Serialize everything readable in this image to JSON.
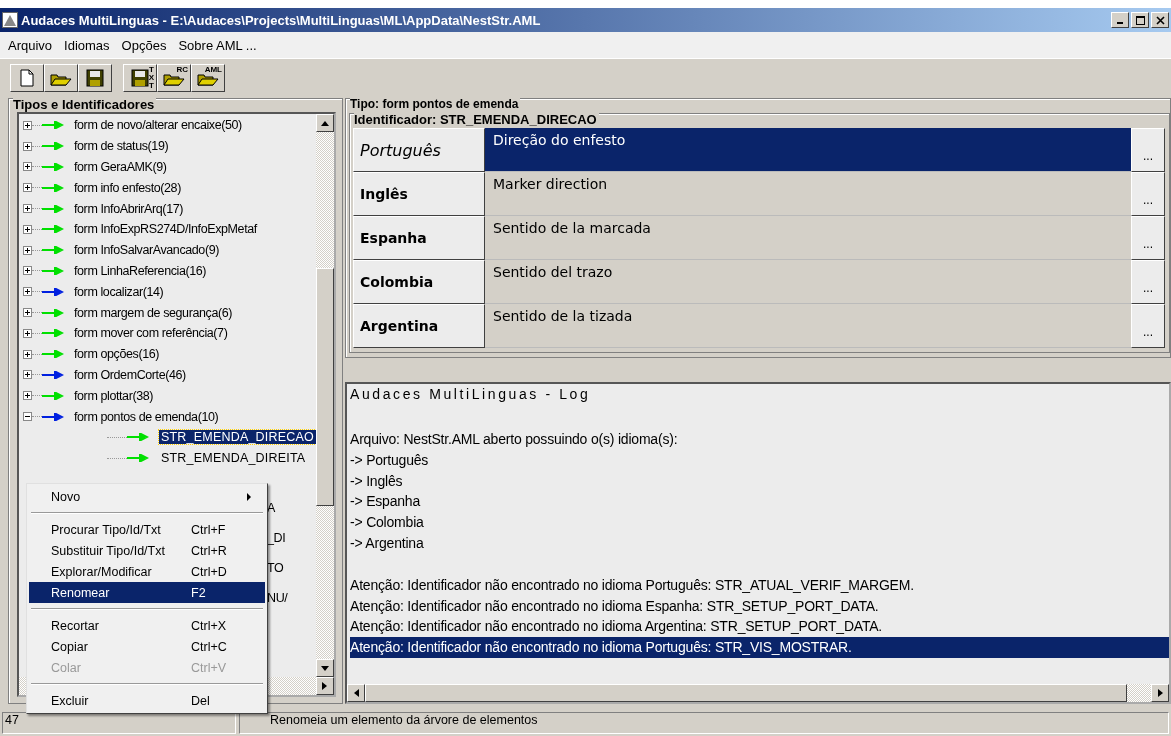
{
  "window": {
    "title": "Audaces MultiLinguas - E:\\Audaces\\Projects\\MultiLinguas\\ML\\AppData\\NestStr.AML"
  },
  "menu": [
    "Arquivo",
    "Idiomas",
    "Opções",
    "Sobre AML ..."
  ],
  "toolbar": [
    {
      "kind": "new"
    },
    {
      "kind": "open"
    },
    {
      "kind": "save"
    },
    {
      "kind": "save",
      "tag": "TXT"
    },
    {
      "kind": "open",
      "tag": "RC"
    },
    {
      "kind": "open",
      "tag": "AML"
    }
  ],
  "tree": {
    "title": "Tipos e Identificadores",
    "items": [
      {
        "label": "form de novo/alterar encaixe(50)",
        "color": "#00e000",
        "expanded": false
      },
      {
        "label": "form de status(19)",
        "color": "#00e000",
        "expanded": false
      },
      {
        "label": "form GeraAMK(9)",
        "color": "#00e000",
        "expanded": false
      },
      {
        "label": "form info enfesto(28)",
        "color": "#00e000",
        "expanded": false
      },
      {
        "label": "form InfoAbrirArq(17)",
        "color": "#00e000",
        "expanded": false
      },
      {
        "label": "form InfoExpRS274D/InfoExpMetaf",
        "color": "#00e000",
        "expanded": false
      },
      {
        "label": "form InfoSalvarAvancado(9)",
        "color": "#00e000",
        "expanded": false
      },
      {
        "label": "form LinhaReferencia(16)",
        "color": "#00e000",
        "expanded": false
      },
      {
        "label": "form localizar(14)",
        "color": "#0020e0",
        "expanded": false
      },
      {
        "label": "form margem de segurança(6)",
        "color": "#00e000",
        "expanded": false
      },
      {
        "label": "form mover com referência(7)",
        "color": "#00e000",
        "expanded": false
      },
      {
        "label": "form opções(16)",
        "color": "#00e000",
        "expanded": false
      },
      {
        "label": "form OrdemCorte(46)",
        "color": "#0020e0",
        "expanded": false
      },
      {
        "label": "form plottar(38)",
        "color": "#00e000",
        "expanded": false
      },
      {
        "label": "form pontos de emenda(10)",
        "color": "#0020e0",
        "expanded": true,
        "children": [
          {
            "label": "STR_EMENDA_DIRECAO",
            "color": "#00e000",
            "selected": true
          },
          {
            "label": "STR_EMENDA_DIREITA",
            "color": "#00e000",
            "selected": false
          },
          {
            "label": "A",
            "kind": "covered"
          },
          {
            "label": "_DI",
            "kind": "covered"
          },
          {
            "label": "TO",
            "kind": "covered"
          },
          {
            "label": "NU/",
            "kind": "covered"
          }
        ]
      }
    ]
  },
  "type_title": "Tipo: form pontos de emenda",
  "identifier_title": "Identificador: STR_EMENDA_DIRECAO",
  "translations": [
    {
      "language": "Português",
      "text": "Direção do enfesto",
      "selected": true,
      "button": "..."
    },
    {
      "language": "Inglês",
      "text": "Marker direction",
      "selected": false,
      "button": "..."
    },
    {
      "language": "Espanha",
      "text": "Sentido de la marcada",
      "selected": false,
      "button": "..."
    },
    {
      "language": "Colombia",
      "text": "Sentido del trazo",
      "selected": false,
      "button": "..."
    },
    {
      "language": "Argentina",
      "text": "Sentido de la tizada",
      "selected": false,
      "button": "..."
    }
  ],
  "log": {
    "title": "Audaces MultiLinguas - Log",
    "lines": [
      {
        "text": "Arquivo:  NestStr.AML aberto possuindo o(s) idioma(s):",
        "selected": false
      },
      {
        "text": " -> Português",
        "selected": false
      },
      {
        "text": " -> Inglês",
        "selected": false
      },
      {
        "text": " -> Espanha",
        "selected": false
      },
      {
        "text": " -> Colombia",
        "selected": false
      },
      {
        "text": " -> Argentina",
        "selected": false
      },
      {
        "kind": "blank"
      },
      {
        "text": "Atenção: Identificador não encontrado no idioma Português: STR_ATUAL_VERIF_MARGEM.",
        "selected": false
      },
      {
        "text": "Atenção: Identificador não encontrado no idioma Espanha: STR_SETUP_PORT_DATA.",
        "selected": false
      },
      {
        "text": "Atenção: Identificador não encontrado no idioma Argentina: STR_SETUP_PORT_DATA.",
        "selected": false
      },
      {
        "text": "Atenção: Identificador não encontrado no idioma Português: STR_VIS_MOSTRAR.",
        "selected": true
      }
    ]
  },
  "context_menu": [
    {
      "kind": "submenu",
      "label": "Novo",
      "selected": false,
      "disabled": false
    },
    {
      "kind": "separator"
    },
    {
      "kind": "item",
      "label": "Procurar Tipo/Id/Txt",
      "shortcut": "Ctrl+F",
      "selected": false,
      "disabled": false
    },
    {
      "kind": "item",
      "label": "Substituir Tipo/Id/Txt",
      "shortcut": "Ctrl+R",
      "selected": false,
      "disabled": false
    },
    {
      "kind": "item",
      "label": "Explorar/Modificar",
      "shortcut": "Ctrl+D",
      "selected": false,
      "disabled": false
    },
    {
      "kind": "item",
      "label": "Renomear",
      "shortcut": "F2",
      "selected": true,
      "disabled": false
    },
    {
      "kind": "separator"
    },
    {
      "kind": "item",
      "label": "Recortar",
      "shortcut": "Ctrl+X",
      "selected": false,
      "disabled": false
    },
    {
      "kind": "item",
      "label": "Copiar",
      "shortcut": "Ctrl+C",
      "selected": false,
      "disabled": false
    },
    {
      "kind": "item",
      "label": "Colar",
      "shortcut": "Ctrl+V",
      "selected": false,
      "disabled": true
    },
    {
      "kind": "separator"
    },
    {
      "kind": "item",
      "label": "Excluir",
      "shortcut": "Del",
      "selected": false,
      "disabled": false
    }
  ],
  "status_bar": [
    "47",
    "Renomeia um elemento da árvore de elementos"
  ]
}
